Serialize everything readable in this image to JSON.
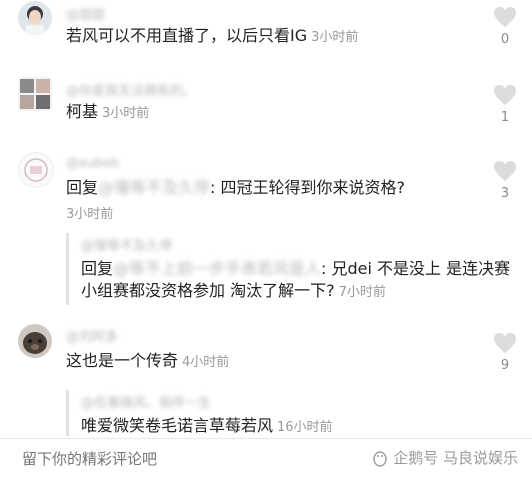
{
  "comments": [
    {
      "username": "@甜甜",
      "text": "若风可以不用直播了，以后只看IG",
      "time": "3小时前",
      "likes": "0"
    },
    {
      "username": "@你是我无法拥有的。",
      "text": "柯基",
      "time": "3小时前",
      "likes": "1"
    },
    {
      "username": "@xubeb",
      "reply_prefix": "回复",
      "reply_target": "@慢等不及久停",
      "text": ": 四冠王轮得到你来说资格?",
      "time": "3小时前",
      "likes": "3",
      "nested": {
        "username": "@慢等不及久停",
        "reply_prefix": "回复",
        "reply_target": "@等不上前一步手表若风是人",
        "line1": ": 兄dei 不是没上 是连决赛",
        "line2": "小组赛都没资格参加 淘汰了解一下?",
        "time": "7小时前"
      }
    },
    {
      "username": "@刘阿多",
      "text": "这也是一个传奇",
      "time": "4小时前",
      "likes": "9",
      "nested": {
        "username": "@任事随风、相伴一生",
        "text": "唯爱微笑卷毛诺言草莓若风",
        "time": "16小时前"
      }
    }
  ],
  "input": {
    "placeholder": "留下你的精彩评论吧"
  },
  "watermark": {
    "text": "企鹅号 马良说娱乐"
  }
}
